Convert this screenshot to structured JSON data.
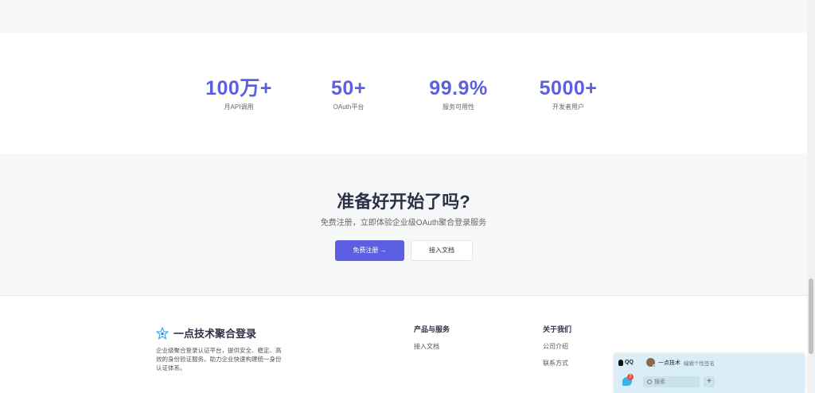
{
  "stats": [
    {
      "value": "100万+",
      "label": "月API调用"
    },
    {
      "value": "50+",
      "label": "OAuth平台"
    },
    {
      "value": "99.9%",
      "label": "服务可用性"
    },
    {
      "value": "5000+",
      "label": "开发者用户"
    }
  ],
  "cta": {
    "title": "准备好开始了吗?",
    "subtitle": "免费注册，立即体验企业级OAuth聚合登录服务",
    "primary_button": "免费注册 →",
    "secondary_button": "接入文档"
  },
  "footer": {
    "brand_name": "一点技术聚合登录",
    "brand_icon": "star-icon",
    "description": "企业级聚合登录认证平台，提供安全、稳定、高效的身份验证服务。助力企业快速构建统一身份认证体系。",
    "columns": [
      {
        "title": "产品与服务",
        "links": [
          "接入文档"
        ]
      },
      {
        "title": "关于我们",
        "links": [
          "公司介绍",
          "联系方式"
        ]
      }
    ]
  },
  "qq_panel": {
    "app_name": "QQ",
    "user_name": "一点技术",
    "status_text": "编辑个性签名",
    "unread_count": "2",
    "search_placeholder": "搜索",
    "add_label": "+"
  },
  "colors": {
    "accent": "#5b5fe0",
    "heading": "#2d3047",
    "qq_panel": "#d9eef7"
  }
}
